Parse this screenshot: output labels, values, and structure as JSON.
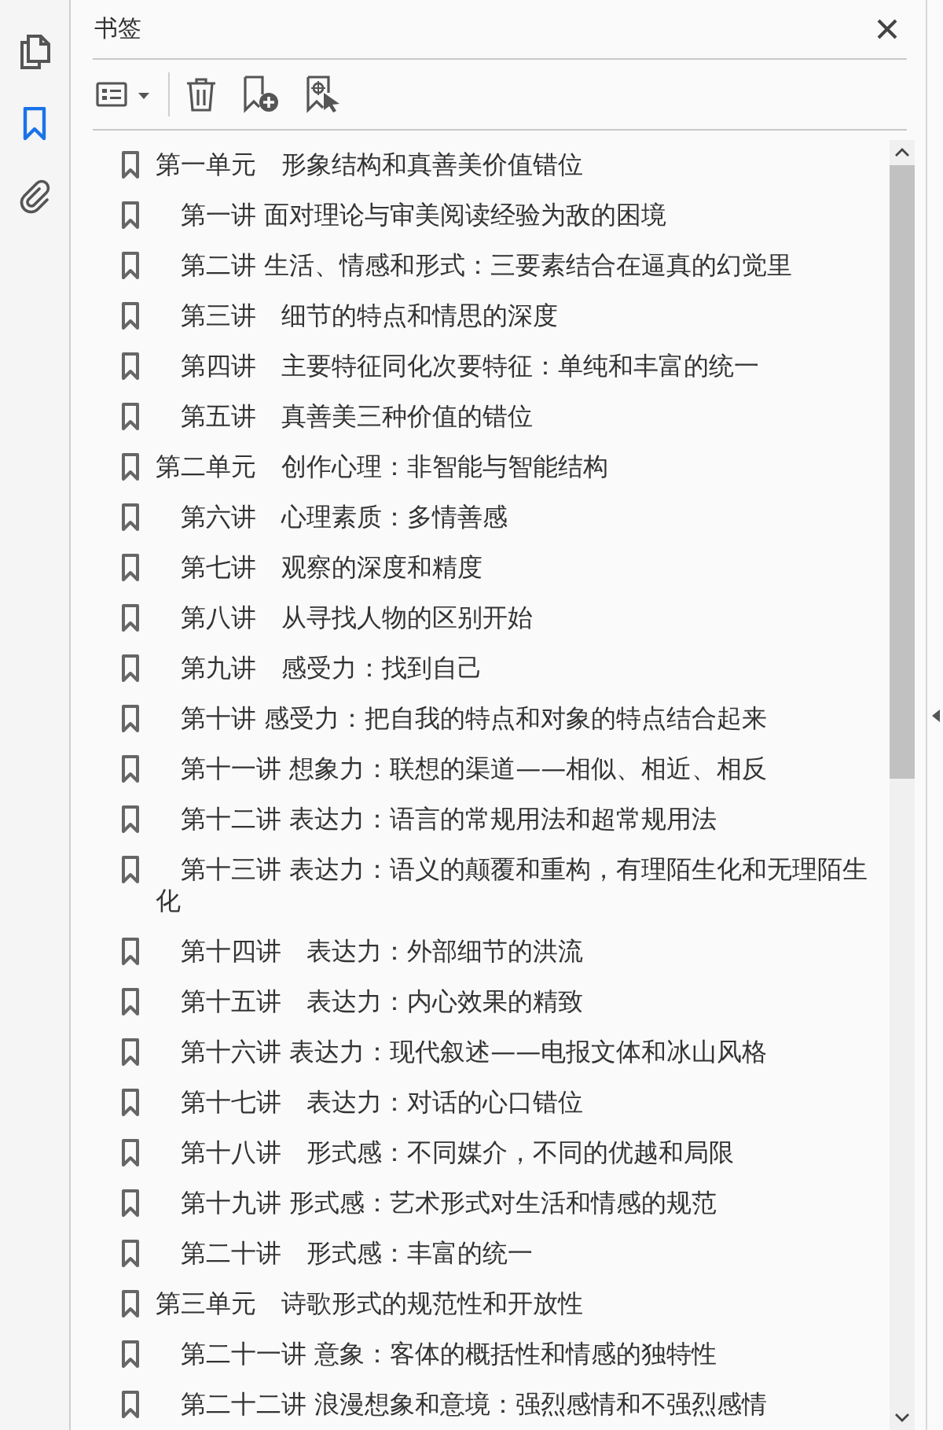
{
  "rail_tabs": [
    {
      "kind": "pages",
      "selected": false
    },
    {
      "kind": "bookmarks",
      "selected": true
    },
    {
      "kind": "attachments",
      "selected": false
    }
  ],
  "panel": {
    "title": "书签"
  },
  "bookmarks": [
    "第一单元　形象结构和真善美价值错位",
    "　第一讲 面对理论与审美阅读经验为敌的困境",
    "　第二讲 生活、情感和形式：三要素结合在逼真的幻觉里",
    "　第三讲　细节的特点和情思的深度",
    "　第四讲　主要特征同化次要特征：单纯和丰富的统一",
    "　第五讲　真善美三种价值的错位",
    "第二单元　创作心理：非智能与智能结构",
    "　第六讲　心理素质：多情善感",
    "　第七讲　观察的深度和精度",
    "　第八讲　从寻找人物的区别开始",
    "　第九讲　感受力：找到自己",
    "　第十讲 感受力：把自我的特点和对象的特点结合起来",
    "　第十一讲 想象力：联想的渠道——相似、相近、相反",
    "　第十二讲 表达力：语言的常规用法和超常规用法",
    "　第十三讲 表达力：语义的颠覆和重构，有理陌生化和无理陌生化",
    "　第十四讲　表达力：外部细节的洪流",
    "　第十五讲　表达力：内心效果的精致",
    "　第十六讲 表达力：现代叙述——电报文体和冰山风格",
    "　第十七讲　表达力：对话的心口错位",
    "　第十八讲　形式感：不同媒介，不同的优越和局限",
    "　第十九讲 形式感：艺术形式对生活和情感的规范",
    "　第二十讲　形式感：丰富的统一",
    "第三单元　诗歌形式的规范性和开放性",
    "　第二十一讲 意象：客体的概括性和情感的独特性",
    "　第二十二讲 浪漫想象和意境：强烈感情和不强烈感情"
  ]
}
